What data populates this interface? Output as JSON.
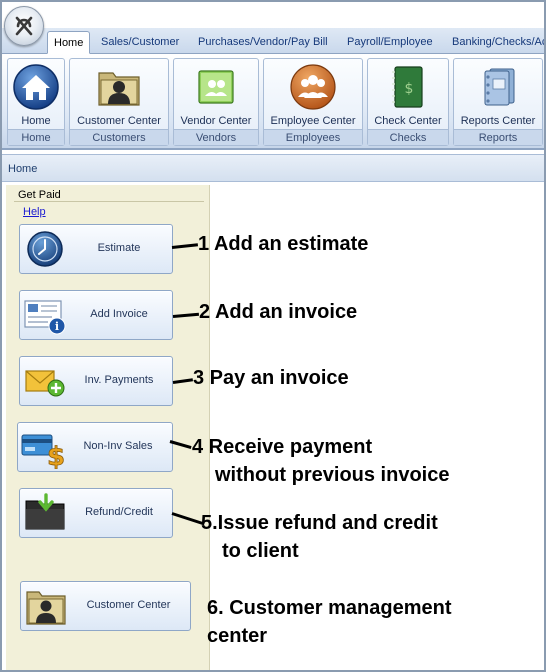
{
  "ribbon": {
    "tabs": [
      {
        "label": "Home"
      },
      {
        "label": "Sales/Customer"
      },
      {
        "label": "Purchases/Vendor/Pay Bill"
      },
      {
        "label": "Payroll/Employee"
      },
      {
        "label": "Banking/Checks/Ac"
      }
    ],
    "groups": [
      {
        "button": "Home",
        "group": "Home",
        "icon": "home-icon"
      },
      {
        "button": "Customer Center",
        "group": "Customers",
        "icon": "customer-folder-icon"
      },
      {
        "button": "Vendor Center",
        "group": "Vendors",
        "icon": "vendor-book-icon"
      },
      {
        "button": "Employee Center",
        "group": "Employees",
        "icon": "employees-icon"
      },
      {
        "button": "Check Center",
        "group": "Checks",
        "icon": "checkbook-icon"
      },
      {
        "button": "Reports Center",
        "group": "Reports",
        "icon": "reports-binder-icon"
      }
    ]
  },
  "breadcrumb": "Home",
  "panel": {
    "title": "Get Paid",
    "help": "Help",
    "actions": [
      {
        "label": "Estimate",
        "icon": "clock-icon"
      },
      {
        "label": "Add Invoice",
        "icon": "invoice-info-icon"
      },
      {
        "label": "Inv. Payments",
        "icon": "envelope-add-icon"
      },
      {
        "label": "Non-Inv Sales",
        "icon": "card-dollar-icon"
      },
      {
        "label": "Refund/Credit",
        "icon": "folder-arrow-icon"
      },
      {
        "label": "Customer Center",
        "icon": "customer-folder-icon"
      }
    ]
  },
  "annotations": [
    {
      "lines": [
        "1 Add an estimate"
      ]
    },
    {
      "lines": [
        "2 Add an invoice"
      ]
    },
    {
      "lines": [
        "3  Pay an invoice"
      ]
    },
    {
      "lines": [
        "4  Receive payment",
        "without previous invoice"
      ]
    },
    {
      "lines": [
        "5.Issue refund and credit",
        "to client"
      ]
    },
    {
      "lines": [
        "6. Customer management",
        "center"
      ]
    }
  ],
  "colors": {
    "ribbon_text": "#1c2f55",
    "panel_bg": "#f2f0d9",
    "link": "#1a1ad1",
    "annotation": "#000000"
  }
}
